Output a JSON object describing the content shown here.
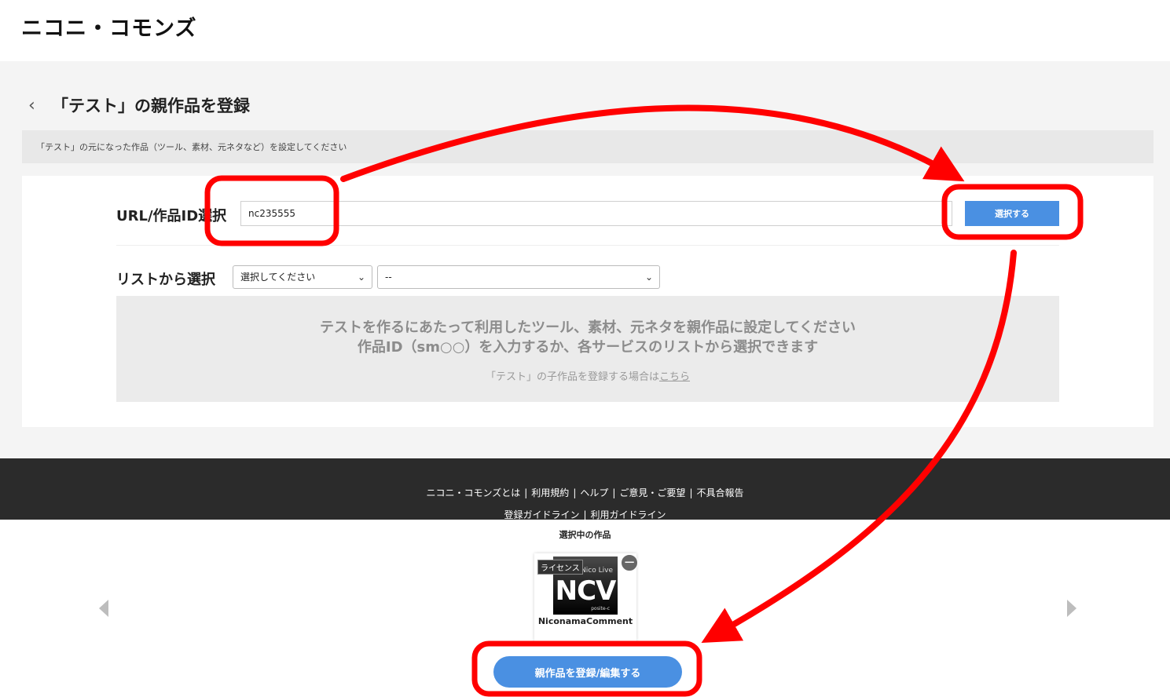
{
  "header": {
    "logo": "ニコニ・コモンズ"
  },
  "page": {
    "title": "「テスト」の親作品を登録",
    "notice": "「テスト」の元になった作品（ツール、素材、元ネタなど）を設定してください"
  },
  "form": {
    "url_label": "URL/作品ID選択",
    "url_value": "nc235555",
    "select_button": "選択する",
    "list_label": "リストから選択",
    "category_dropdown": "選択してください",
    "list_dropdown": "--"
  },
  "info": {
    "line1": "テストを作るにあたって利用したツール、素材、元ネタを親作品に設定してください",
    "line2": "作品ID（sm○○）を入力するか、各サービスのリストから選択できます",
    "sub_prefix": "「テスト」の子作品を登録する場合は",
    "sub_link": "こちら"
  },
  "footer": {
    "links_row1": [
      "ニコニ・コモンズとは",
      "利用規約",
      "ヘルプ",
      "ご意見・ご要望",
      "不具合報告"
    ],
    "links_row2": [
      "登録ガイドライン",
      "利用ガイドライン"
    ]
  },
  "selected": {
    "label": "選択中の作品",
    "item": {
      "badge": "ライセンス",
      "thumb_top": "Nico Live",
      "thumb_main": "NCV",
      "thumb_bottom": "posite-c",
      "title": "NiconamaComment"
    },
    "register_button": "親作品を登録/編集する"
  },
  "colors": {
    "accent": "#4a90e2",
    "annotation": "#ff0000",
    "footer_bg": "#2b2b2b"
  }
}
